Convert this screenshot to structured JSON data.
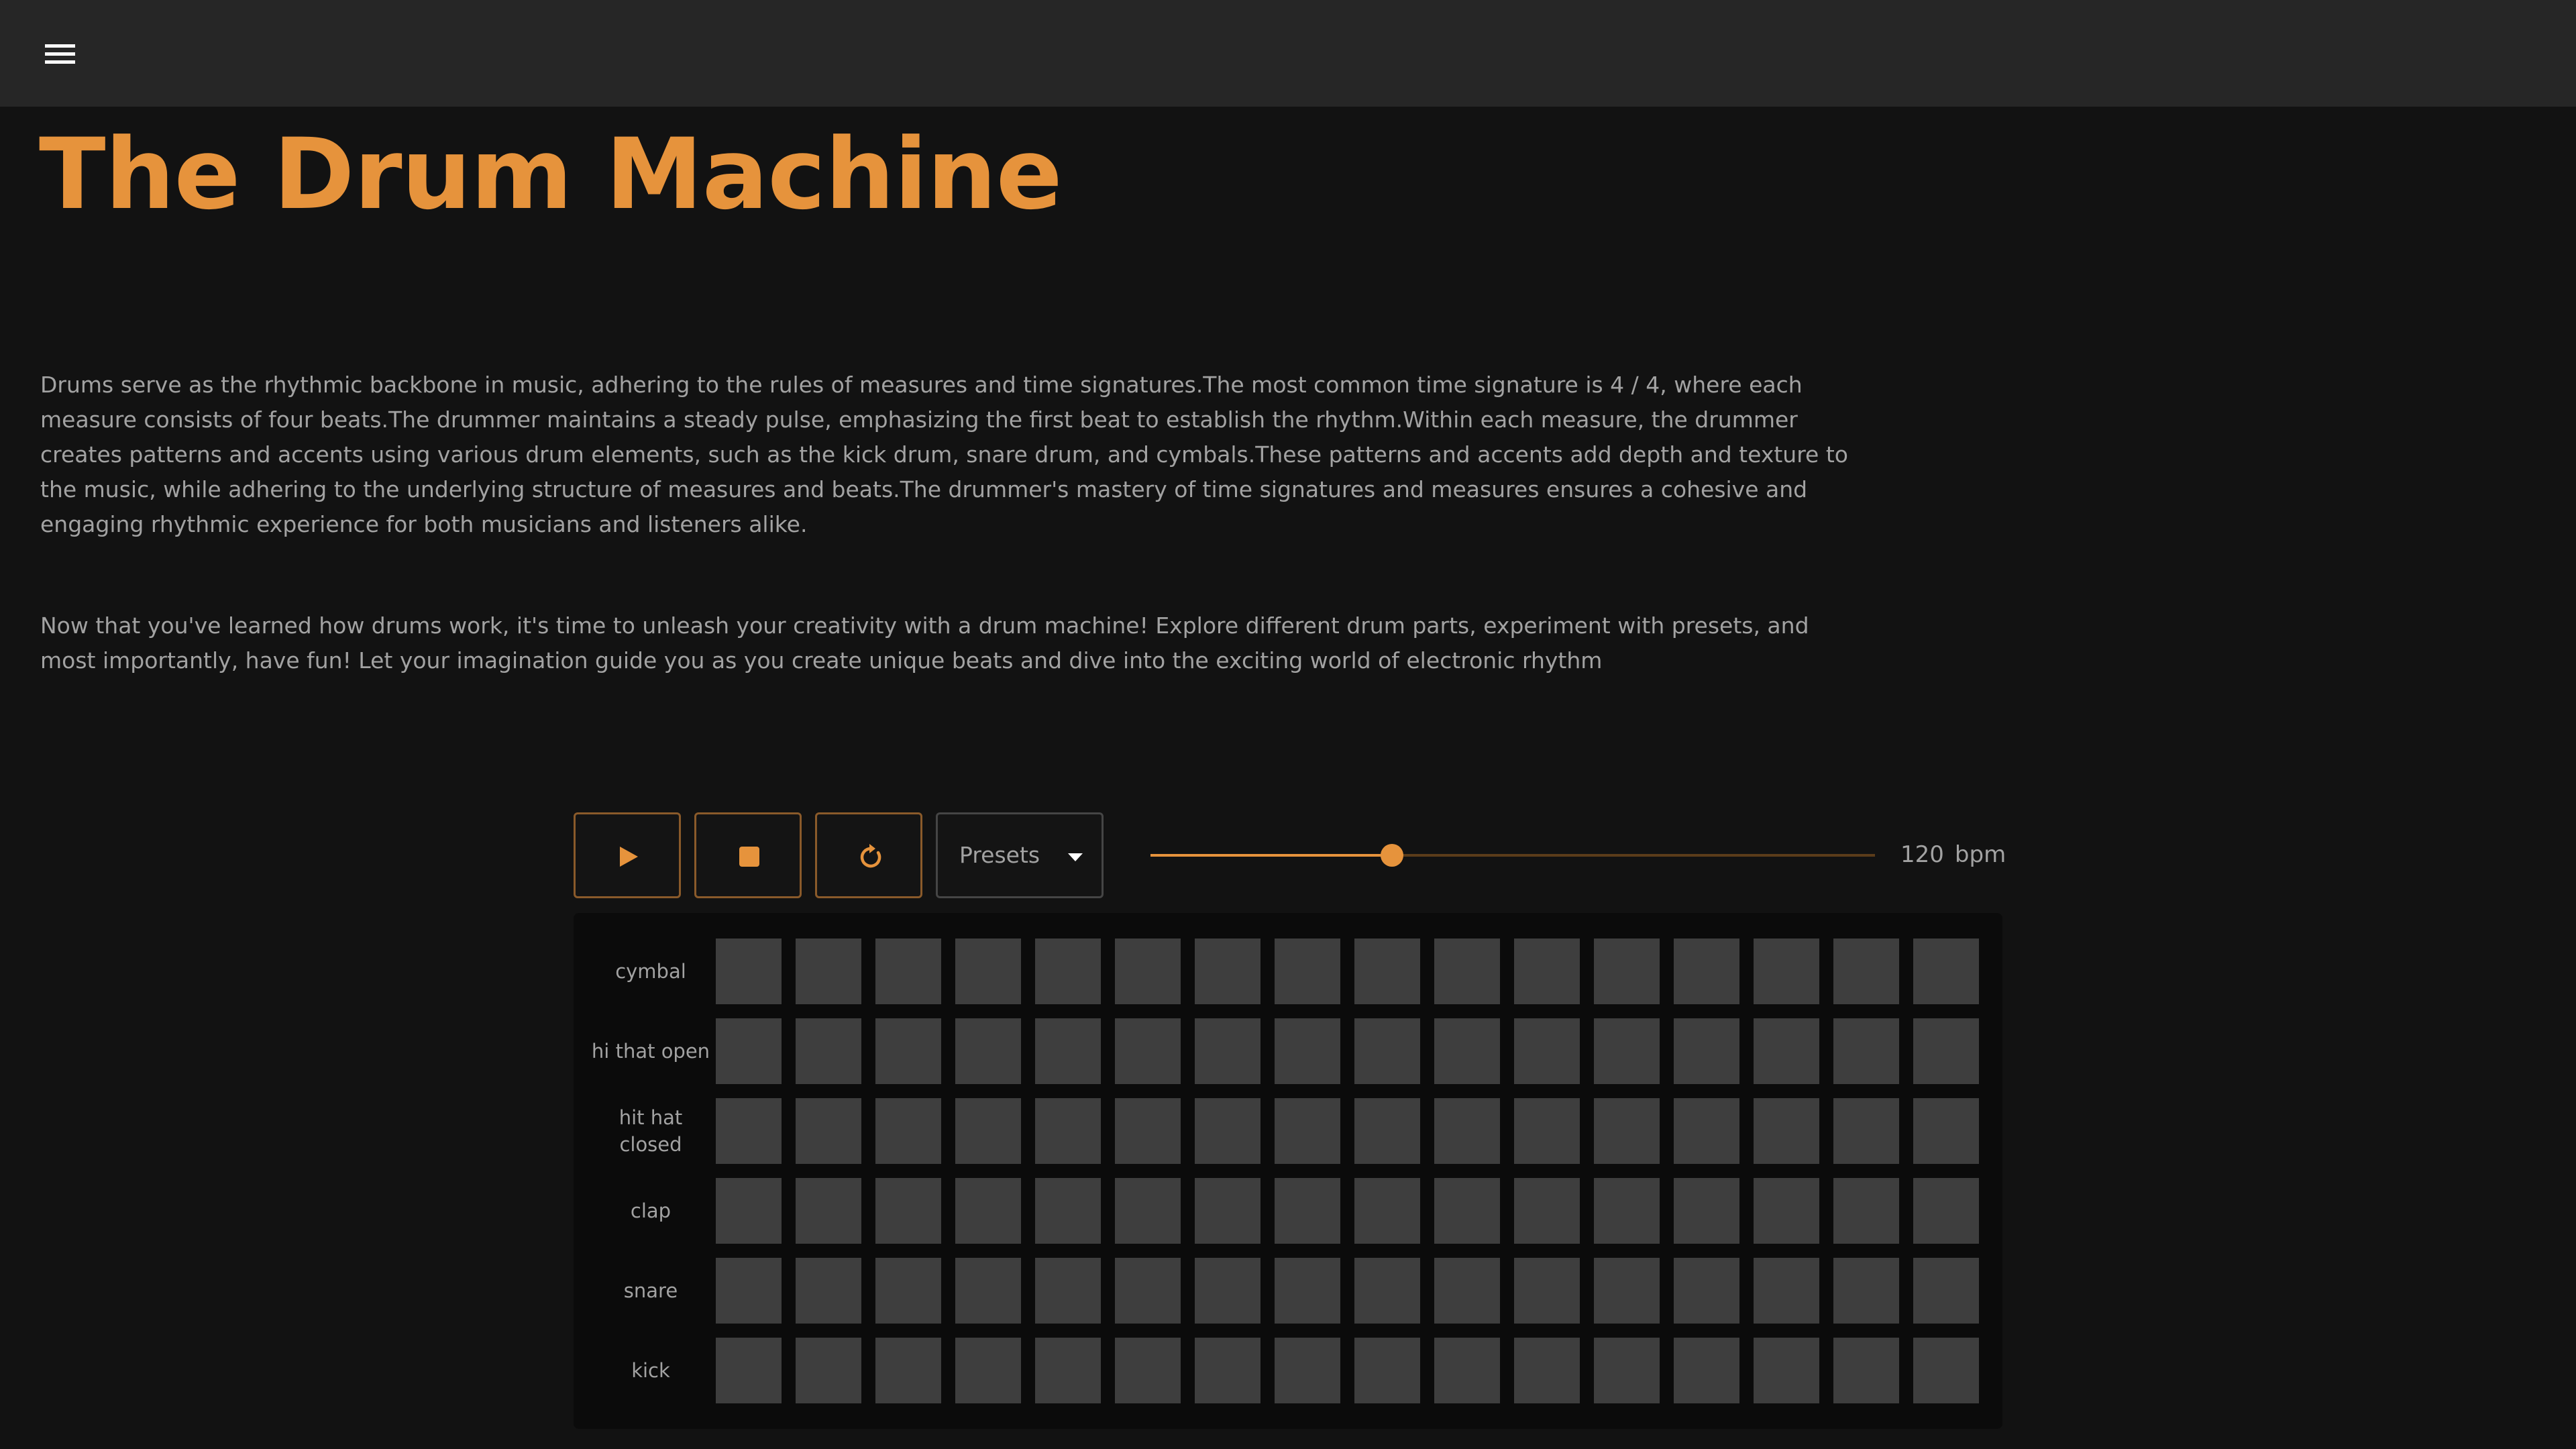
{
  "header": {
    "menu_icon": "hamburger-menu-icon"
  },
  "page": {
    "title": "The Drum Machine",
    "paragraph1": "Drums serve as the rhythmic backbone in music, adhering to the rules of measures and time signatures.The most common time signature is 4 / 4, where each measure consists of four beats.The drummer maintains a steady pulse, emphasizing the first beat to establish the rhythm.Within each measure, the drummer creates patterns and accents using various drum elements, such as the kick drum, snare drum, and cymbals.These patterns and accents add depth and texture to the music, while adhering to the underlying structure of measures and beats.The drummer's mastery of time signatures and measures ensures a cohesive and engaging rhythmic experience for both musicians and listeners alike.",
    "paragraph2": "Now that you've learned how drums work, it's time to unleash your creativity with a drum machine! Explore different drum parts, experiment with presets, and most importantly, have fun! Let your imagination guide you as you create unique beats and dive into the exciting world of electronic rhythm"
  },
  "controls": {
    "play_icon": "play-icon",
    "stop_icon": "stop-icon",
    "reset_icon": "reset-icon",
    "presets_label": "Presets",
    "presets_icon": "caret-down-icon",
    "tempo_value": "120",
    "tempo_unit": "bpm",
    "tempo_fraction": 0.333
  },
  "sequencer": {
    "steps": 16,
    "rows": [
      {
        "label": "cymbal"
      },
      {
        "label": "hi that open"
      },
      {
        "label": "hit hat closed"
      },
      {
        "label": "clap"
      },
      {
        "label": "snare"
      },
      {
        "label": "kick"
      }
    ]
  },
  "colors": {
    "accent": "#e6933c",
    "background": "#121212",
    "topbar": "#262626",
    "pad_inactive": "#3e3e3e",
    "text": "#a2a2a2"
  }
}
